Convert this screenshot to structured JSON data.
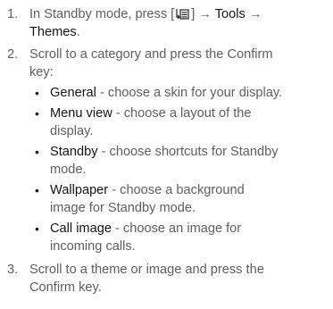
{
  "steps": [
    {
      "number": "1.",
      "text_a": "In Standby mode, press [",
      "key_icon": "menu-key-icon",
      "text_b": "] →",
      "kw1": "Tools",
      "arrow": "→",
      "kw2": "Themes",
      "end": "."
    },
    {
      "number": "2.",
      "line1": "Scroll to a category and press the Confirm",
      "line2": "key:"
    },
    {
      "number": "3.",
      "line1": "Scroll to a theme or image and press the",
      "line2": "Confirm key."
    }
  ],
  "bullets": [
    {
      "term": "General",
      "desc1": " - choose a skin for your display.",
      "desc2": ""
    },
    {
      "term": "Menu view",
      "desc1": " - choose a layout of the",
      "desc2": "display."
    },
    {
      "term": "Standby",
      "desc1": " - choose shortcuts for Standby",
      "desc2": "mode."
    },
    {
      "term": "Wallpaper",
      "desc1": " - choose a background",
      "desc2": "image for Standby mode."
    },
    {
      "term": "Call image",
      "desc1": " - choose an image for",
      "desc2": "incoming calls."
    }
  ],
  "bullet_char": "•"
}
